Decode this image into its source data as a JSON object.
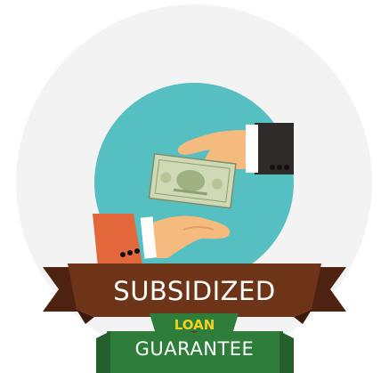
{
  "badge": {
    "line1": "SUBSIDIZED",
    "line2": "LOAN",
    "line3": "GUARANTEE"
  },
  "colors": {
    "backdrop": "#f3f3f3",
    "disc": "#55bfc2",
    "ribbon": "#6e3418",
    "ribbon_shade": "#4d2210",
    "ribbon_band": "#2f7d3a",
    "loan_text": "#f2d21e",
    "sleeve_right": "#2e2b2a",
    "sleeve_left": "#e2673a",
    "skin": "#f5bb7e",
    "banknote": "#cfd9b6"
  },
  "icons": {
    "disc": "teal-circle",
    "upper_hand": "hand-giving-icon",
    "lower_hand": "hand-receiving-icon",
    "note": "banknote-icon"
  }
}
